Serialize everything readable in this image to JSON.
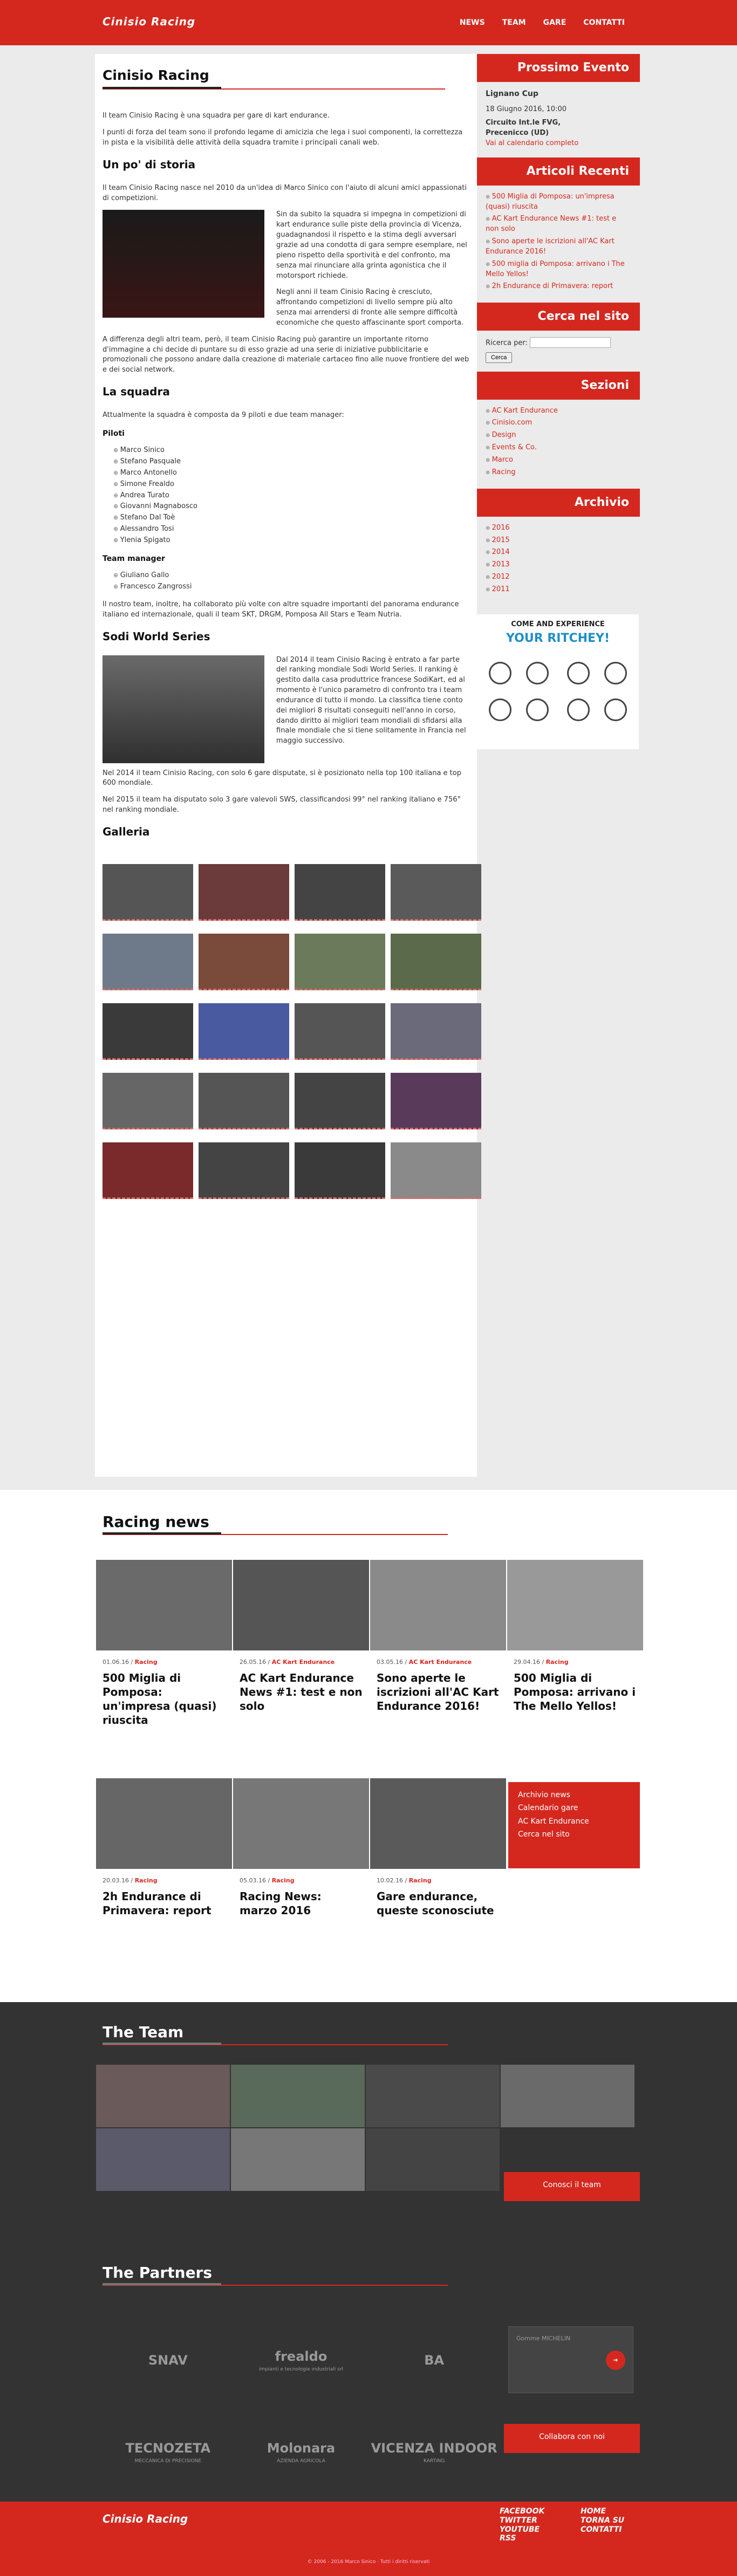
{
  "header": {
    "logo": "Cinisio Racing",
    "nav": [
      "News",
      "Team",
      "Gare",
      "Contatti"
    ]
  },
  "main": {
    "title": "Cinisio Racing",
    "intro": [
      "Il team Cinisio Racing è una squadra per gare di kart endurance.",
      "I punti di forza del team sono il profondo legame di amicizia che lega i suoi componenti, la correttezza in pista e la visibilità delle attività della squadra tramite i principali canali web."
    ],
    "storia_title": "Un po' di storia",
    "storia": [
      "Il team Cinisio Racing nasce nel 2010 da un'idea di Marco Sinico con l'aiuto di alcuni amici appassionati di competizioni.",
      "Sin da subito la squadra si impegna in competizioni di kart endurance sulle piste della provincia di Vicenza, guadagnandosi il rispetto e la stima degli avversari grazie ad una condotta di gara sempre esemplare, nel pieno rispetto della sportività e del confronto, ma senza mai rinunciare alla grinta agonistica che il motorsport richiede.",
      "Negli anni il team Cinisio Racing è cresciuto, affrontando competizioni di livello sempre più alto senza mai arrendersi di fronte alle sempre difficoltà economiche che questo affascinante sport comporta.",
      "A differenza degli altri team, però, il team Cinisio Racing può garantire un importante ritorno d'immagine a chi decide di puntare su di esso grazie ad una serie di iniziative pubblicitarie e promozionali che possono andare dalla creazione di materiale cartaceo fino alle nuove frontiere del web e dei social network."
    ],
    "squadra_title": "La squadra",
    "squadra_intro": "Attualmente la squadra è composta da 9 piloti e due team manager:",
    "piloti_title": "Piloti",
    "piloti": [
      "Marco Sinico",
      "Stefano Pasquale",
      "Marco Antonello",
      "Simone Frealdo",
      "Andrea Turato",
      "Giovanni Magnabosco",
      "Stefano Dal Toè",
      "Alessandro Tosi",
      "Ylenia Spigato"
    ],
    "manager_title": "Team manager",
    "manager": [
      "Giuliano Gallo",
      "Francesco Zangrossi"
    ],
    "squadra_outro": "Il nostro team, inoltre, ha collaborato più volte con altre squadre importanti del panorama endurance italiano ed internazionale, quali il team SKT, DRGM, Pomposa All Stars e Team Nutria.",
    "sws_title": "Sodi World Series",
    "sws": [
      "Dal 2014 il team Cinisio Racing è entrato a far parte del ranking mondiale Sodi World Series. Il ranking è gestito dalla casa produttrice francese SodiKart, ed al momento è l'unico parametro di confronto tra i team endurance di tutto il mondo. La classifica tiene conto dei migliori 8 risultati conseguiti nell'anno in corso, dando diritto ai migliori team mondiali di sfidarsi alla finale mondiale che si tiene solitamente in Francia nel maggio successivo.",
      "Nel 2014 il team Cinisio Racing, con solo 6 gare disputate, si è posizionato nella top 100 italiana e top 600 mondiale.",
      "Nel 2015 il team ha disputato solo 3 gare valevoli SWS, classificandosi 99° nel ranking italiano e 756° nel ranking mondiale."
    ],
    "galleria_title": "Galleria"
  },
  "sidebar": {
    "evento_title": "Prossimo Evento",
    "evento_name": "Lignano Cup",
    "evento_date": "18 Giugno 2016, 10:00",
    "evento_place1": "Circuito Int.le FVG,",
    "evento_place2": "Precenicco (UD)",
    "evento_link": "Vai al calendario completo",
    "articoli_title": "Articoli Recenti",
    "articoli": [
      "500 Miglia di Pomposa: un'impresa (quasi) riuscita",
      "AC Kart Endurance News #1: test e non solo",
      "Sono aperte le iscrizioni all'AC Kart Endurance 2016!",
      "500 miglia di Pomposa: arrivano i The Mello Yellos!",
      "2h Endurance di Primavera: report"
    ],
    "cerca_title": "Cerca nel sito",
    "cerca_label": "Ricerca per:",
    "cerca_button": "Cerca",
    "sezioni_title": "Sezioni",
    "sezioni": [
      "AC Kart Endurance",
      "Cinisio.com",
      "Design",
      "Events & Co.",
      "Marco",
      "Racing"
    ],
    "archivio_title": "Archivio",
    "archivio": [
      "2016",
      "2015",
      "2014",
      "2013",
      "2012",
      "2011"
    ],
    "ad_line1": "COME AND EXPERIENCE",
    "ad_line2": "YOUR RITCHEY!"
  },
  "news": {
    "title": "Racing news",
    "items": [
      {
        "date": "01.06.16",
        "cat": "Racing",
        "title": "500 Miglia di Pomposa: un'impresa (quasi) riuscita"
      },
      {
        "date": "26.05.16",
        "cat": "AC Kart Endurance",
        "title": "AC Kart Endurance News #1: test e non solo"
      },
      {
        "date": "03.05.16",
        "cat": "AC Kart Endurance",
        "title": "Sono aperte le iscrizioni all'AC Kart Endurance 2016!"
      },
      {
        "date": "29.04.16",
        "cat": "Racing",
        "title": "500 Miglia di Pomposa: arrivano i The Mello Yellos!"
      },
      {
        "date": "20.03.16",
        "cat": "Racing",
        "title": "2h Endurance di Primavera: report"
      },
      {
        "date": "05.03.16",
        "cat": "Racing",
        "title": "Racing News: marzo 2016"
      },
      {
        "date": "10.02.16",
        "cat": "Racing",
        "title": "Gare endurance, queste sconosciute"
      }
    ],
    "quicklinks": [
      "Archivio news",
      "Calendario gare",
      "AC Kart Endurance",
      "Cerca nel sito"
    ]
  },
  "team": {
    "title": "The Team",
    "button": "Conosci il team"
  },
  "partners": {
    "title": "The Partners",
    "items": [
      {
        "name": "SNAV"
      },
      {
        "name": "frealdo",
        "sub": "impianti e tecnologie industriali srl"
      },
      {
        "name": "BA"
      },
      {
        "name": "TECNOZETA",
        "sub": "MECCANICA DI PRECISIONE"
      },
      {
        "name": "Molonara",
        "sub": "AZIENDA AGRICOLA"
      },
      {
        "name": "VICENZA INDOOR",
        "sub": "KARTING"
      }
    ],
    "michelin": "Gomme MICHELIN",
    "button": "Collabora con noi"
  },
  "footer": {
    "logo": "Cinisio Racing",
    "social": [
      "Facebook",
      "Twitter",
      "Youtube",
      "RSS"
    ],
    "links": [
      "Home",
      "Torna su",
      "Contatti"
    ],
    "copyright": "© 2006 - 2016 Marco Sinico · Tutti i diritti riservati"
  },
  "colors": {
    "accent": "#d4281f",
    "dark": "#333333"
  }
}
